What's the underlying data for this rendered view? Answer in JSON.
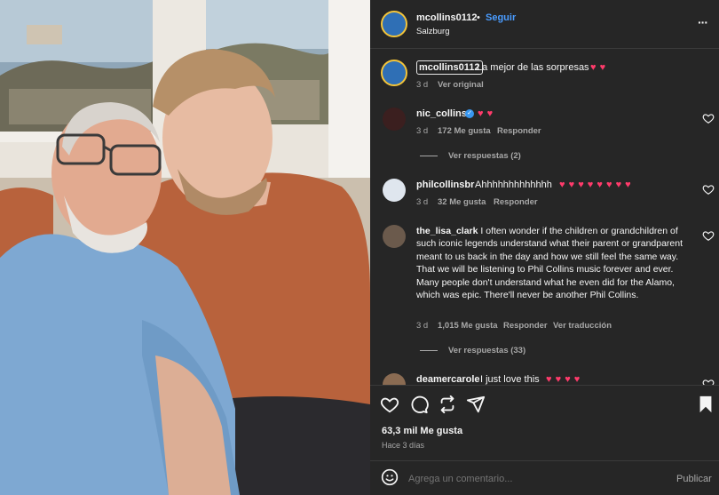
{
  "post": {
    "author": "mcollins0112",
    "dot": "•",
    "follow_label": "Seguir",
    "location": "Salzburg",
    "more_label": "···"
  },
  "caption": {
    "author": "mcollins0112",
    "text": "La mejor de las sorpresas",
    "hearts": 2,
    "time": "3 d",
    "translate": "Ver original"
  },
  "comments": [
    {
      "user": "nic_collins",
      "verified": true,
      "text": "",
      "hearts": 2,
      "time": "3 d",
      "likes": "172 Me gusta",
      "reply": "Responder",
      "translation": "",
      "replies": "Ver respuestas (2)"
    },
    {
      "user": "philcollinsbr",
      "verified": false,
      "text": "Ahhhhhhhhhhhhh",
      "hearts": 8,
      "time": "3 d",
      "likes": "32 Me gusta",
      "reply": "Responder",
      "translation": "",
      "replies": ""
    },
    {
      "user": "the_lisa_clark",
      "verified": false,
      "text": "I often wonder if the children or grandchildren of such iconic legends understand what their parent or grandparent meant to us back in the day and how we still feel the same way. That we will be listening to Phil Collins music forever and ever. Many people don't understand what he even did for the Alamo, which was epic. There'll never be another Phil Collins.",
      "hearts": 0,
      "time": "3 d",
      "likes": "1,015 Me gusta",
      "reply": "Responder",
      "translation": "Ver traducción",
      "replies": "Ver respuestas (33)"
    },
    {
      "user": "deamercarole",
      "verified": false,
      "text": "I just love this",
      "hearts": 4,
      "time": "",
      "likes": "",
      "reply": "",
      "translation": "",
      "replies": ""
    }
  ],
  "actions": {
    "likes_count": "63,3 mil Me gusta",
    "posted": "Hace 3 días"
  },
  "composer": {
    "placeholder": "Agrega un comentario...",
    "publish_label": "Publicar"
  },
  "colors": {
    "panel_bg": "#262626",
    "follow": "#4a9cff",
    "heart": "#ff3b6b",
    "verified": "#3897f0"
  },
  "icons": [
    "emoji-icon",
    "heart-icon",
    "comment-icon",
    "repost-icon",
    "share-icon",
    "bookmark-icon",
    "verified-icon",
    "more-icon"
  ]
}
